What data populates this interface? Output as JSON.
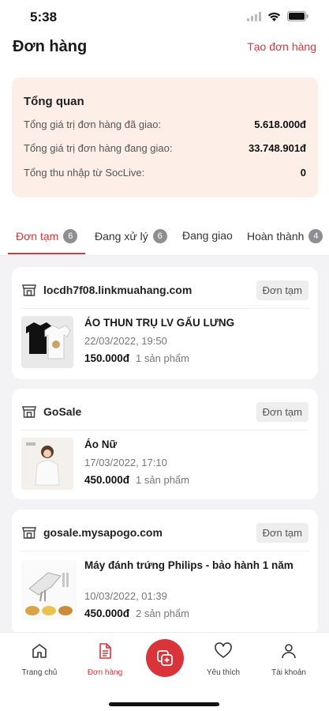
{
  "status_bar": {
    "time": "5:38"
  },
  "header": {
    "title": "Đơn hàng",
    "create_order": "Tạo đơn hàng"
  },
  "overview": {
    "title": "Tổng quan",
    "rows": [
      {
        "label": "Tổng giá trị đơn hàng đã giao:",
        "value": "5.618.000đ"
      },
      {
        "label": "Tổng giá trị đơn hàng đang giao:",
        "value": "33.748.901đ"
      },
      {
        "label": "Tổng thu nhập từ SocLive:",
        "value": "0"
      }
    ]
  },
  "tabs": [
    {
      "label": "Đơn tạm",
      "badge": "6",
      "active": true
    },
    {
      "label": "Đang xử lý",
      "badge": "6",
      "active": false
    },
    {
      "label": "Đang giao",
      "badge": "",
      "active": false
    },
    {
      "label": "Hoàn thành",
      "badge": "4",
      "active": false
    }
  ],
  "orders": [
    {
      "shop": "locdh7f08.linkmuahang.com",
      "status": "Đơn tạm",
      "product": "ÁO THUN TRỤ LV GẤU LƯNG",
      "date": "22/03/2022, 19:50",
      "price": "150.000đ",
      "qty": "1 sản phẩm"
    },
    {
      "shop": "GoSale",
      "status": "Đơn tạm",
      "product": "Áo Nữ",
      "date": "17/03/2022, 17:10",
      "price": "450.000đ",
      "qty": "1 sản phẩm"
    },
    {
      "shop": "gosale.mysapogo.com",
      "status": "Đơn tạm",
      "product": "Máy đánh trứng Philips - bảo hành 1 năm",
      "date": "10/03/2022, 01:39",
      "price": "450.000đ",
      "qty": "2 sản phẩm"
    }
  ],
  "bottom_nav": [
    {
      "label": "Trang chủ",
      "icon": "home-icon"
    },
    {
      "label": "Đơn hàng",
      "icon": "document-icon"
    },
    {
      "label": "",
      "icon": "add-square-icon"
    },
    {
      "label": "Yêu thích",
      "icon": "heart-icon"
    },
    {
      "label": "Tài khoản",
      "icon": "user-icon"
    }
  ],
  "colors": {
    "accent": "#d8343a",
    "overview_bg": "#fdeee7",
    "badge": "#8e8e93"
  }
}
